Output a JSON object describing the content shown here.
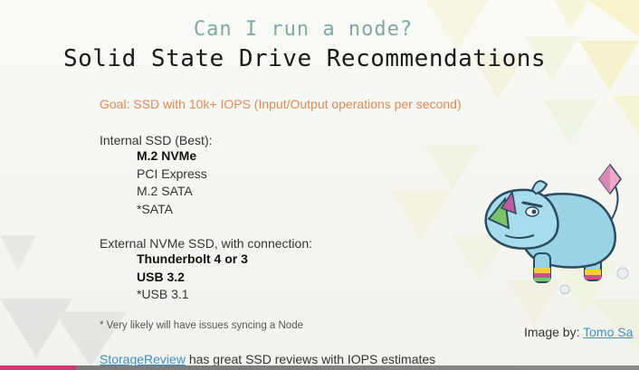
{
  "slide": {
    "subtitle": "Can I run a node?",
    "title": "Solid State Drive Recommendations",
    "goal": "Goal: SSD with 10k+ IOPS (Input/Output operations per second)",
    "internal": {
      "heading": "Internal SSD (Best):",
      "items": [
        {
          "label": "M.2 NVMe",
          "bold": true
        },
        {
          "label": "PCI Express",
          "bold": false
        },
        {
          "label": "M.2 SATA",
          "bold": false
        },
        {
          "label": "*SATA",
          "bold": false
        }
      ]
    },
    "external": {
      "heading": "External NVMe SSD, with connection:",
      "items": [
        {
          "label": "Thunderbolt 4 or 3",
          "bold": true
        },
        {
          "label": "USB 3.2",
          "bold": true
        },
        {
          "label": "*USB 3.1",
          "bold": false
        }
      ]
    },
    "footnote": "* Very likely will have issues syncing a Node",
    "storage_link": "StorageReview",
    "storage_text": " has great SSD reviews with IOPS estimates",
    "credit_prefix": "Image by: ",
    "credit_link": "Tomo Sa"
  },
  "colors": {
    "subtitle": "#7fa8a4",
    "goal": "#e0895a",
    "link": "#3d8fc8",
    "accent": "#ce3a72"
  }
}
